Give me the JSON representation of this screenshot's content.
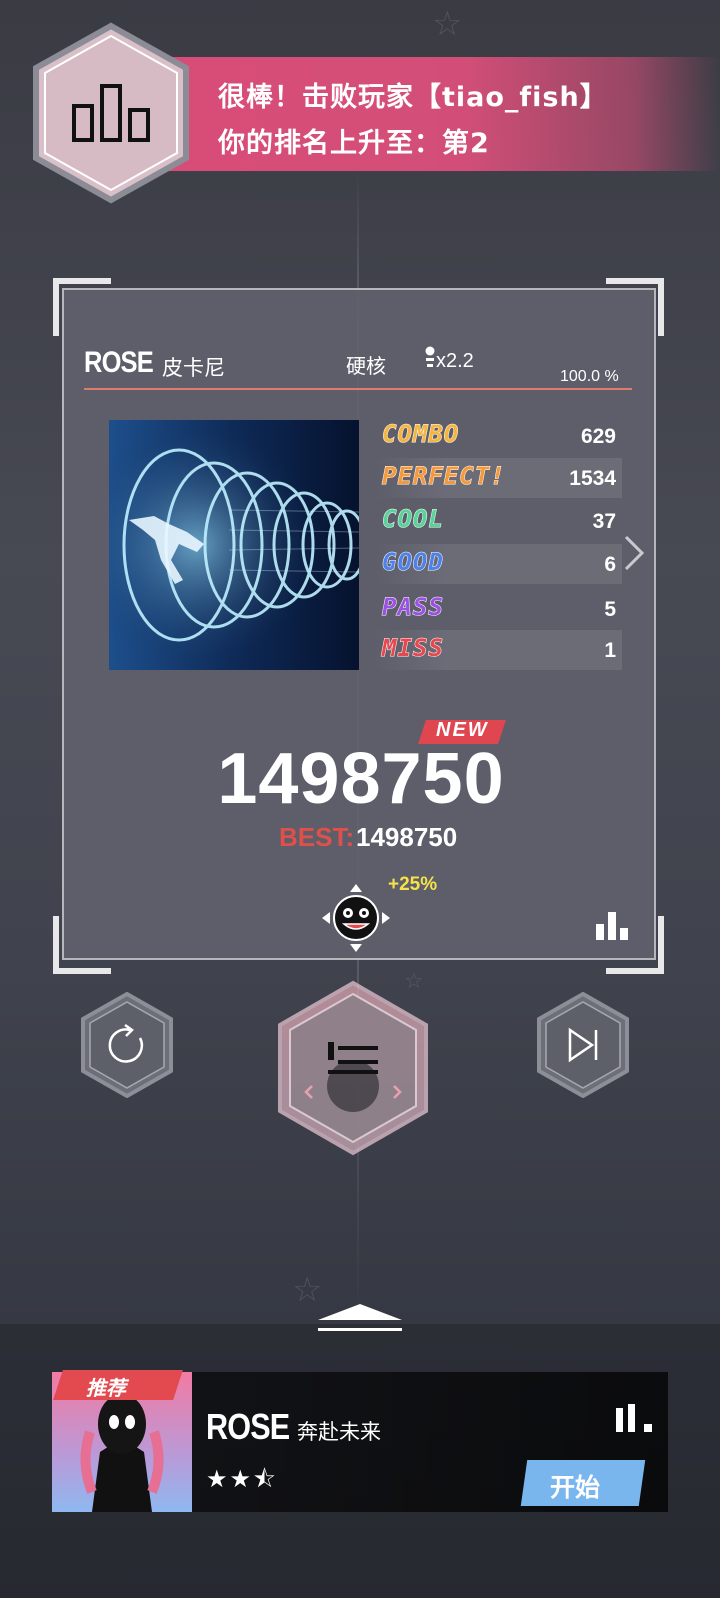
{
  "banner": {
    "line1": "很棒！击败玩家【tiao_fish】",
    "line2": "你的排名上升至：第2",
    "rank_icon": "leaderboard-icon"
  },
  "result": {
    "song_title": "ROSE",
    "artist": "皮卡尼",
    "difficulty": "硬核",
    "speed": "x2.2",
    "accuracy": "100.0 %",
    "judgements": [
      {
        "label": "COMBO",
        "value": "629",
        "color": "#f5b541"
      },
      {
        "label": "PERFECT!",
        "value": "1534",
        "color": "#f59a3c"
      },
      {
        "label": "COOL",
        "value": "37",
        "color": "#59d39a"
      },
      {
        "label": "GOOD",
        "value": "6",
        "color": "#4f82e8"
      },
      {
        "label": "PASS",
        "value": "5",
        "color": "#9a53e0"
      },
      {
        "label": "MISS",
        "value": "1",
        "color": "#e5494f"
      }
    ],
    "new_badge": "NEW",
    "score": "1498750",
    "best_label": "BEST:",
    "best_value": "1498750",
    "bonus": "+25%"
  },
  "controls": {
    "retry_icon": "retry-icon",
    "play_next_icon": "skip-next-icon",
    "menu_icon": "list-icon"
  },
  "recommend": {
    "tag": "推荐",
    "title": "ROSE",
    "subtitle": "奔赴未来",
    "stars": "★★⯪",
    "start": "开始",
    "colors": {
      "tag": "#e34a4f",
      "start": "#7ab6ee"
    }
  }
}
